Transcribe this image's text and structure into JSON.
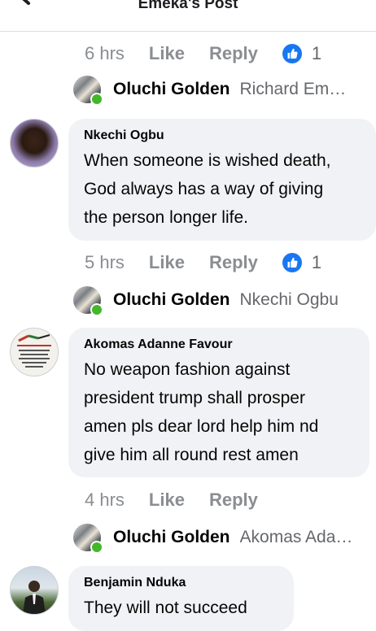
{
  "header": {
    "title": "Emeka's Post"
  },
  "actions": {
    "like": "Like",
    "reply": "Reply"
  },
  "threads": [
    {
      "time": "6 hrs",
      "like_count": "1",
      "reply": {
        "name": "Oluchi Golden",
        "snippet": "Richard Emeka"
      }
    },
    {
      "name": "Nkechi Ogbu",
      "text_lines": [
        "When someone is wished death,",
        "God always has a way of giving",
        "the person longer life."
      ],
      "time": "5 hrs",
      "like_count": "1",
      "reply": {
        "name": "Oluchi Golden",
        "snippet": "Nkechi Ogbu"
      }
    },
    {
      "name": "Akomas Adanne Favour",
      "text_lines": [
        "No weapon fashion against",
        "president trump shall prosper",
        "amen pls dear lord help him nd",
        "give him all round rest amen"
      ],
      "time": "4 hrs",
      "reply": {
        "name": "Oluchi Golden",
        "snippet": "Akomas Adanne Favour"
      }
    },
    {
      "name": "Benjamin Nduka",
      "text_lines": [
        "They will not succeed"
      ]
    }
  ],
  "colors": {
    "online": "#42b72a",
    "like_blue": "#1877f2",
    "bubble": "#f0f2f5"
  }
}
